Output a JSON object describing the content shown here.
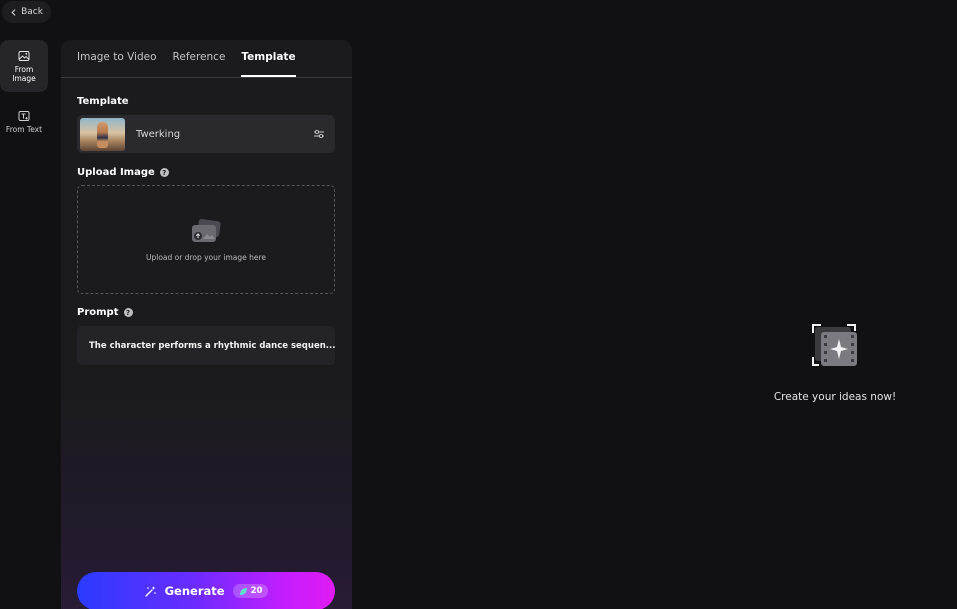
{
  "nav": {
    "back_label": "Back"
  },
  "rail": {
    "items": [
      {
        "label_line1": "From",
        "label_line2": "Image",
        "icon": "image-icon",
        "active": true
      },
      {
        "label_line1": "From Text",
        "label_line2": "",
        "icon": "text-icon",
        "active": false
      }
    ]
  },
  "tabs": [
    {
      "label": "Image to Video",
      "active": false
    },
    {
      "label": "Reference",
      "active": false
    },
    {
      "label": "Template",
      "active": true
    }
  ],
  "template_section": {
    "label": "Template",
    "selected_name": "Twerking",
    "settings_icon": "sliders-icon"
  },
  "upload_section": {
    "label": "Upload Image",
    "hint": "Upload or drop your image here",
    "icon": "upload-image-icon"
  },
  "prompt_section": {
    "label": "Prompt",
    "value": "The character performs a rhythmic dance sequen..."
  },
  "generate": {
    "label": "Generate",
    "credits": "20",
    "gradient_start": "#2a3bff",
    "gradient_end": "#e11cf2"
  },
  "empty_state": {
    "text": "Create your ideas now!",
    "icon": "video-sparkle-icon"
  }
}
